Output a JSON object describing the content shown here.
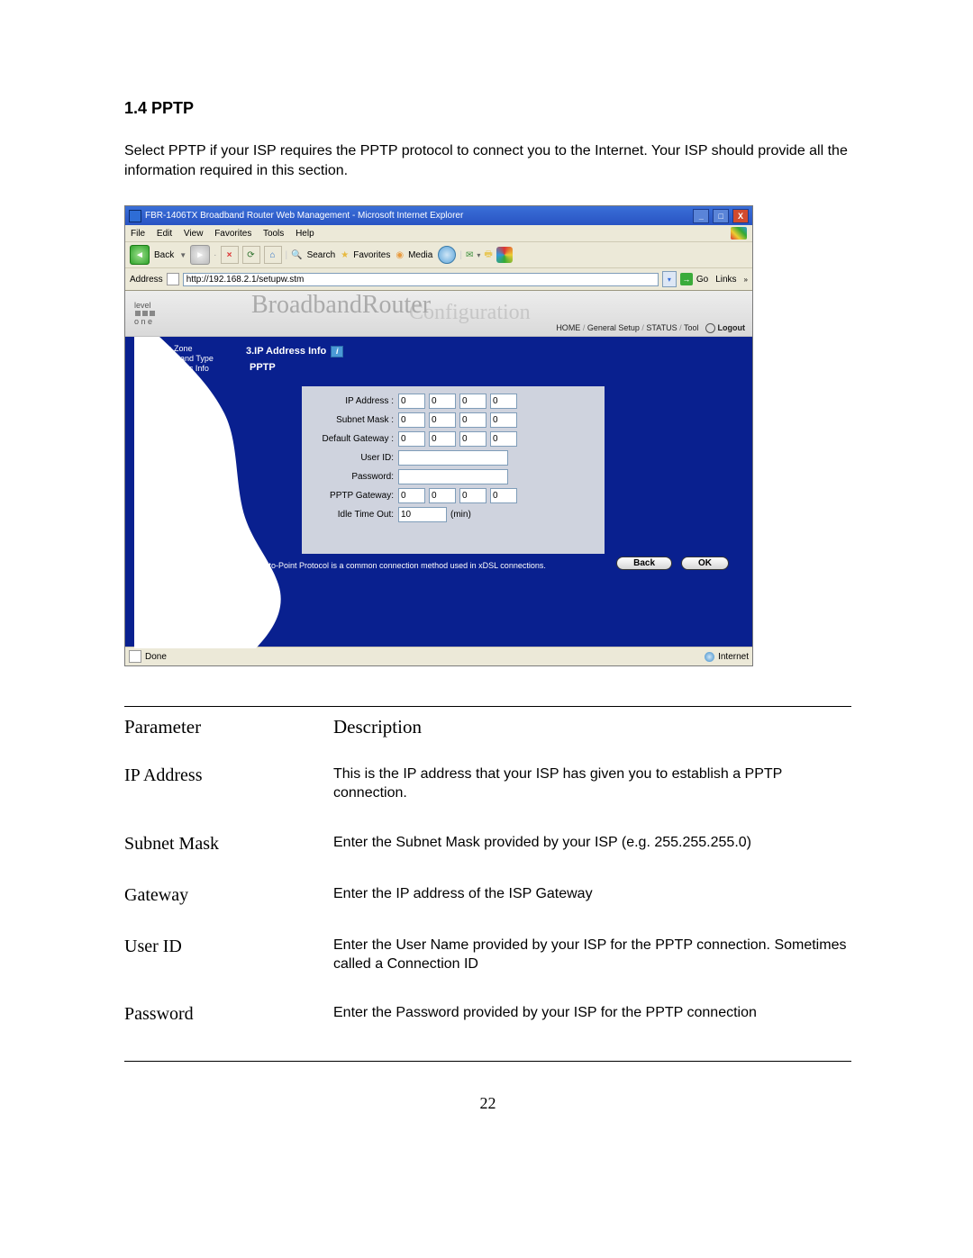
{
  "heading": "1.4 PPTP",
  "intro": "Select PPTP if your ISP requires the PPTP protocol to connect you to the Internet. Your ISP should provide all the information required in this section.",
  "ie": {
    "title": "FBR-1406TX Broadband Router Web Management - Microsoft Internet Explorer",
    "menu": {
      "file": "File",
      "edit": "Edit",
      "view": "View",
      "favorites": "Favorites",
      "tools": "Tools",
      "help": "Help"
    },
    "toolbar": {
      "back": "Back",
      "search": "Search",
      "favorites": "Favorites",
      "media": "Media"
    },
    "address_label": "Address",
    "url": "http://192.168.2.1/setupw.stm",
    "go": "Go",
    "links": "Links",
    "status_done": "Done",
    "status_zone": "Internet"
  },
  "router": {
    "logo_top": "level",
    "logo_bot": "o n e",
    "title": "BroadbandRouter",
    "subtitle": "Configuration",
    "crumb": {
      "home": "HOME",
      "gs": "General Setup",
      "status": "STATUS",
      "tool": "Tool",
      "logout": "Logout"
    },
    "sidebar": [
      "1. Time Zone",
      "2. Broadband Type",
      "3. IP Address Info"
    ],
    "section": "3.IP Address Info",
    "subhead": "PPTP",
    "form": {
      "ip_label": "IP Address :",
      "subnet_label": "Subnet Mask :",
      "gateway_label": "Default Gateway :",
      "user_label": "User ID:",
      "pass_label": "Password:",
      "pptp_label": "PPTP Gateway:",
      "idle_label": "Idle Time Out:",
      "octet": "0",
      "idle_value": "10",
      "idle_unit": "(min)"
    },
    "hint": "Point-to-Point Protocol is a common connection method used in xDSL connections.",
    "btn_back": "Back",
    "btn_ok": "OK"
  },
  "desc": {
    "hdr_param": "Parameter",
    "hdr_desc": "Description",
    "rows": [
      {
        "p": "IP Address",
        "d": "This is the IP address that your ISP has given you to establish a PPTP connection."
      },
      {
        "p": "Subnet Mask",
        "d": "Enter the Subnet Mask provided by your ISP (e.g. 255.255.255.0)"
      },
      {
        "p": "Gateway",
        "d": "Enter the IP address of the ISP Gateway"
      },
      {
        "p": "User ID",
        "d": "Enter the User Name provided by your ISP for the PPTP connection. Sometimes called a Connection ID"
      },
      {
        "p": "Password",
        "d": "Enter the Password provided by your ISP for the PPTP connection"
      }
    ]
  },
  "page_number": "22"
}
